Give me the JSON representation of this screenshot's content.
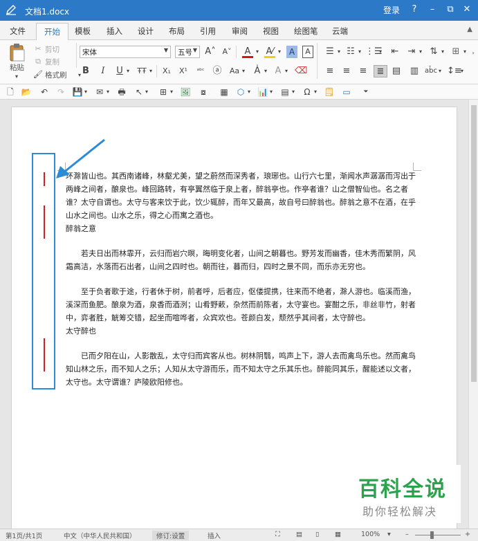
{
  "titlebar": {
    "doc_title": "文档1.docx",
    "login": "登录",
    "help": "?",
    "minimize": "–",
    "restore": "⧉",
    "close": "✕"
  },
  "tabs": [
    {
      "label": "文件"
    },
    {
      "label": "开始",
      "active": true
    },
    {
      "label": "模板"
    },
    {
      "label": "插入"
    },
    {
      "label": "设计"
    },
    {
      "label": "布局"
    },
    {
      "label": "引用"
    },
    {
      "label": "审阅"
    },
    {
      "label": "视图"
    },
    {
      "label": "绘图笔"
    },
    {
      "label": "云端"
    }
  ],
  "ribbon": {
    "paste": "粘贴",
    "cut": "剪切",
    "copy": "复制",
    "format_painter": "格式刷",
    "font_name": "宋体",
    "font_size": "五号",
    "bold": "B",
    "italic": "I",
    "underline": "U",
    "strike": "ŦŦ",
    "subscript": "X₁",
    "superscript": "X¹"
  },
  "document": {
    "paragraphs": [
      "环滁皆山也。其西南诸峰，林壑尤美，望之蔚然而深秀者，琅琊也。山行六七里，渐闻水声潺潺而泻出于两峰之间者，酿泉也。峰回路转，有亭翼然临于泉上者，醉翁亭也。作亭者谁？山之僧智仙也。名之者谁？太守自谓也。太守与客来饮于此，饮少辄醉，而年又最高，故自号曰醉翁也。醉翁之意不在酒，在乎山水之间也。山水之乐，得之心而寓之酒也。",
      "醉翁之意",
      "若夫日出而林霏开，云归而岩穴暝，晦明变化者，山间之朝暮也。野芳发而幽香，佳木秀而繁阴，风霜高洁，水落而石出者，山间之四时也。朝而往，暮而归，四时之景不同，而乐亦无穷也。",
      "至于负者歌于途，行者休于树，前者呼，后者应，伛偻提携，往来而不绝者，滁人游也。临溪而渔，溪深而鱼肥。酿泉为酒，泉香而酒洌；山肴野蔌，杂然而前陈者，太守宴也。宴酣之乐，非丝非竹，射者中，弈者胜，觥筹交错，起坐而喧哗者，众宾欢也。苍颜白发，颓然乎其间者，太守醉也。",
      "太守醉也",
      "已而夕阳在山，人影散乱，太守归而宾客从也。树林阴翳，鸣声上下，游人去而禽鸟乐也。然而禽鸟知山林之乐，而不知人之乐；人知从太守游而乐，而不知太守之乐其乐也。醉能同其乐，醒能述以文者，太守也。太守谓谁？庐陵欧阳修也。"
    ]
  },
  "watermark": {
    "title": "百科全说",
    "subtitle": "助你轻松解决"
  },
  "status": {
    "page": "第1页/共1页",
    "language": "中文（中华人民共和国）",
    "revision": "修订:设置",
    "insert_mode": "插入",
    "zoom": "100%"
  },
  "colors": {
    "titlebar": "#2b79c7",
    "accent": "#2b79c7",
    "annotation_box": "#2b8bd6",
    "change_mark": "#d22020",
    "watermark_green": "#2ca24d"
  }
}
